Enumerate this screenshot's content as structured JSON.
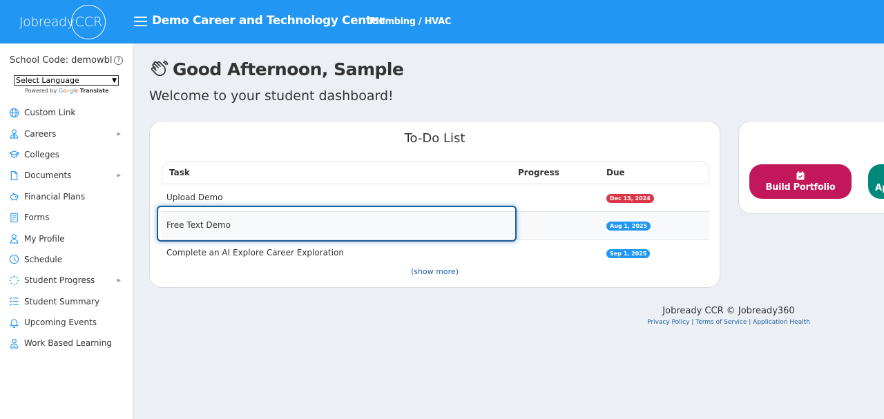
{
  "header": {
    "logo_text": "Jobready",
    "logo_suffix": "CCR",
    "org_title": "Demo Career and Technology Center",
    "program": "Plumbing / HVAC",
    "brand_color": "#2196f3"
  },
  "sidebar": {
    "school_code": "School Code: demowbl",
    "language_select": "Select Language",
    "powered_by": "Powered by",
    "google": "Google",
    "translate": "Translate",
    "items": [
      {
        "label": "Custom Link",
        "icon": "globe-icon"
      },
      {
        "label": "Careers",
        "icon": "user-tie-icon",
        "has_submenu": true
      },
      {
        "label": "Colleges",
        "icon": "graduation-cap-icon"
      },
      {
        "label": "Documents",
        "icon": "file-icon",
        "has_submenu": true
      },
      {
        "label": "Financial Plans",
        "icon": "piggy-bank-icon"
      },
      {
        "label": "Forms",
        "icon": "form-icon"
      },
      {
        "label": "My Profile",
        "icon": "user-icon"
      },
      {
        "label": "Schedule",
        "icon": "clock-icon"
      },
      {
        "label": "Student Progress",
        "icon": "spinner-icon",
        "has_submenu": true
      },
      {
        "label": "Student Summary",
        "icon": "list-check-icon"
      },
      {
        "label": "Upcoming Events",
        "icon": "bell-icon"
      },
      {
        "label": "Work Based Learning",
        "icon": "user-badge-icon"
      }
    ]
  },
  "main": {
    "greeting": "Good Afternoon, Sample",
    "welcome": "Welcome to your student dashboard!",
    "todo": {
      "title": "To-Do List",
      "columns": {
        "task": "Task",
        "progress": "Progress",
        "due": "Due"
      },
      "rows": [
        {
          "task": "Upload Demo",
          "due": "Dec 15, 2024",
          "due_color": "#dc3545"
        },
        {
          "task": "Free Text Demo",
          "due": "Aug 1, 2025",
          "due_color": "#2196f3"
        },
        {
          "task": "Complete an AI Explore Career Exploration",
          "due": "Sep 1, 2025",
          "due_color": "#2196f3"
        }
      ],
      "show_more": "(show more)"
    },
    "actions": {
      "build_portfolio": "Build Portfolio",
      "build_portfolio_color": "#c2185b",
      "apply_partial": "Ap",
      "apply_color": "#00897b"
    }
  },
  "footer": {
    "copyright": "Jobready CCR © Jobready360",
    "privacy": "Privacy Policy",
    "terms": "Terms of Service",
    "health": "Application Health"
  }
}
